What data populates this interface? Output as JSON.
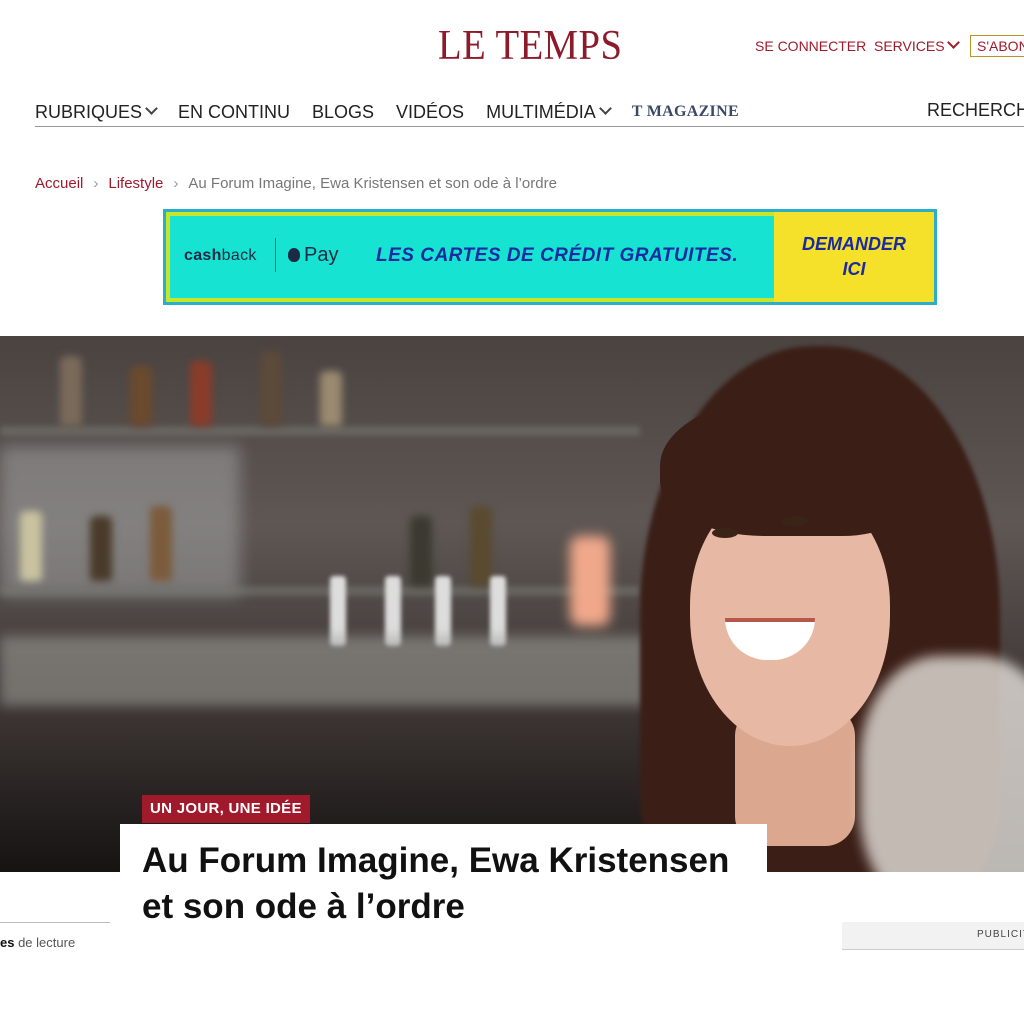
{
  "header": {
    "logo": "LE TEMPS",
    "login": "SE CONNECTER",
    "services": "SERVICES",
    "subscribe": "S'ABON"
  },
  "nav": {
    "items": [
      "RUBRIQUES",
      "EN CONTINU",
      "BLOGS",
      "VIDÉOS",
      "MULTIMÉDIA",
      "T MAGAZINE"
    ],
    "search": "RECHERCH"
  },
  "breadcrumb": {
    "home": "Accueil",
    "section": "Lifestyle",
    "current": "Au Forum Imagine, Ewa Kristensen et son ode à l’ordre",
    "separator": "›"
  },
  "ad": {
    "brand_cash": "cash",
    "brand_back": "back",
    "pay": "Pay",
    "tagline": "LES CARTES DE CRÉDIT GRATUITES.",
    "cta_line1": "DEMANDER",
    "cta_line2": "ICI",
    "colors": {
      "teal": "#16e3d2",
      "yellow": "#f6e12a",
      "border": "#2aaec9",
      "text": "#1a2aa0"
    }
  },
  "article": {
    "tag": "UN JOUR, UNE IDÉE",
    "headline": "Au Forum Imagine, Ewa Kristensen et son ode à l’ordre",
    "reading_strong": "es",
    "reading_rest": " de lecture"
  },
  "sidebar": {
    "publicity": "PUBLICIT"
  },
  "colors": {
    "brand": "#8d1a2b",
    "accent": "#a01a2c"
  }
}
